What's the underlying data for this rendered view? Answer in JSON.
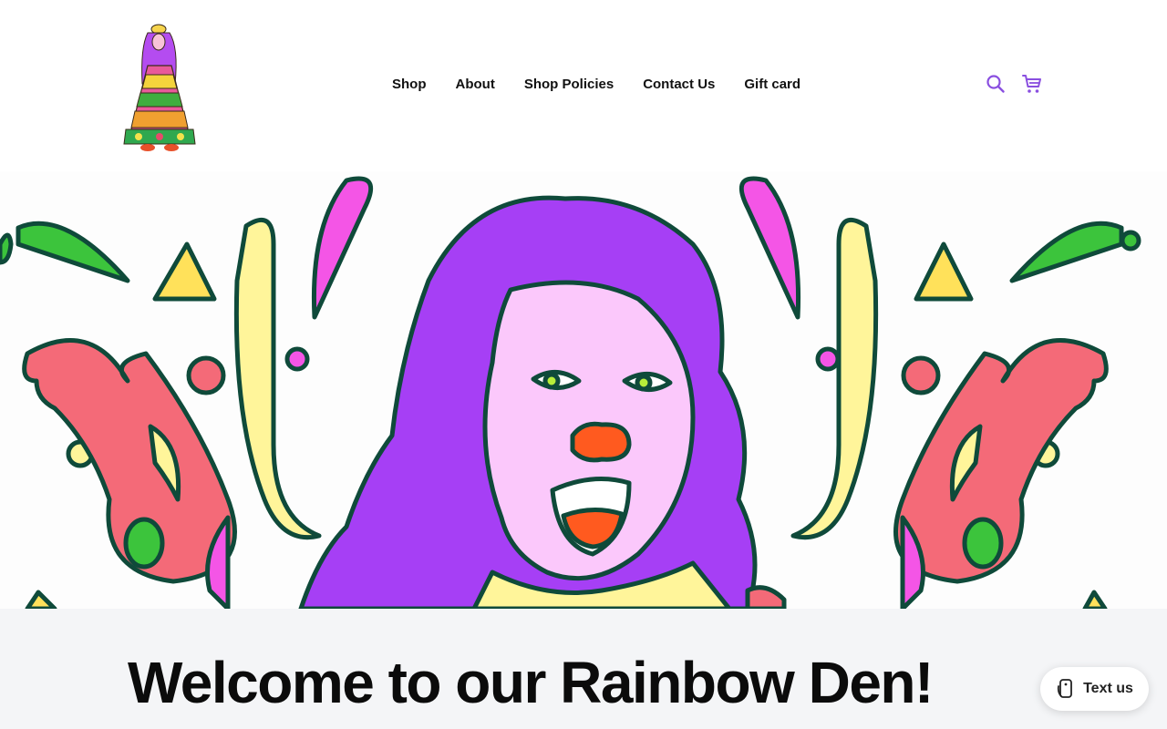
{
  "header": {
    "logo_alt": "Leslie Butterfly Vintage",
    "nav": [
      {
        "label": "Shop"
      },
      {
        "label": "About"
      },
      {
        "label": "Shop Policies"
      },
      {
        "label": "Contact Us"
      },
      {
        "label": "Gift card"
      }
    ],
    "icons": {
      "search": "search-icon",
      "cart": "cart-icon"
    },
    "icon_color": "#8a4fe0"
  },
  "hero": {
    "description_colors": {
      "hair": "#a63ff5",
      "skin": "#fbc8fb",
      "nose": "#ff5a1f",
      "outline": "#0f4a3a",
      "coral": "#f46a78",
      "yellow": "#fff59a",
      "green": "#3cc43c",
      "pink": "#f455e6"
    }
  },
  "welcome": {
    "title": "Welcome to our Rainbow Den!"
  },
  "chat_widget": {
    "label": "Text us",
    "icon": "chat-phone-icon"
  }
}
